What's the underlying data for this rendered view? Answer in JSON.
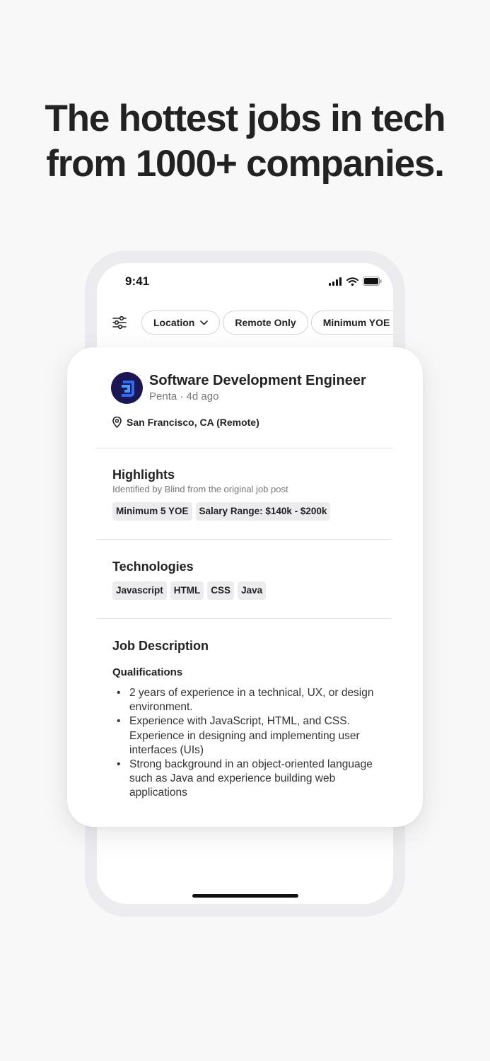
{
  "headline": {
    "line1": "The hottest jobs in tech",
    "line2": "from 1000+ companies."
  },
  "status_bar": {
    "time": "9:41",
    "icons": [
      "signal-icon",
      "wifi-icon",
      "battery-icon"
    ]
  },
  "filters": {
    "icon": "sliders-icon",
    "chips": [
      {
        "label": "Location",
        "has_dropdown": true
      },
      {
        "label": "Remote Only",
        "has_dropdown": false
      },
      {
        "label": "Minimum YOE",
        "has_dropdown": true
      }
    ]
  },
  "job": {
    "title": "Software Development Engineer",
    "company": "Penta",
    "posted": "4d ago",
    "subline": "Penta · 4d ago",
    "location": "San Francisco, CA (Remote)"
  },
  "highlights": {
    "title": "Highlights",
    "subtitle": "Identified by Blind from the original job post",
    "tags": [
      "Minimum 5 YOE",
      "Salary Range: $140k - $200k"
    ]
  },
  "technologies": {
    "title": "Technologies",
    "tags": [
      "Javascript",
      "HTML",
      "CSS",
      "Java"
    ]
  },
  "description": {
    "title": "Job Description",
    "qualifications_title": "Qualifications",
    "bullets": [
      "2 years of experience in a technical, UX, or design environment.",
      "Experience with JavaScript, HTML, and CSS. Experience in designing and implementing user interfaces (UIs)",
      "Strong background in an object-oriented language such as Java and experience building web applications"
    ]
  },
  "colors": {
    "background": "#f8f8f8",
    "phone_frame": "#ececf0",
    "logo_bg": "#1b1755",
    "logo_accent": "#2f6bff",
    "tag_bg": "#ececef"
  }
}
